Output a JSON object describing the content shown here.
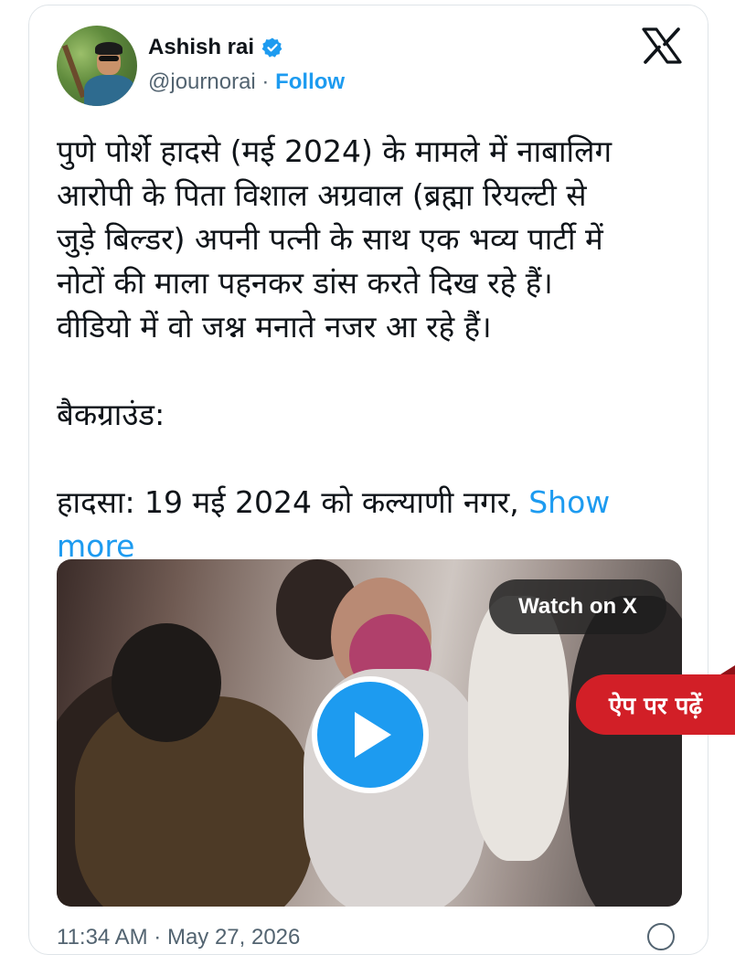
{
  "author": {
    "name": "Ashish rai",
    "handle": "@journorai",
    "separator": " · ",
    "follow_label": "Follow"
  },
  "tweet": {
    "text": "पुणे पोर्शे हादसे (मई 2024) के मामले में नाबालिग\nआरोपी के पिता विशाल अग्रवाल (ब्रह्मा रियल्टी से\nजुड़े बिल्डर) अपनी पत्नी के साथ एक भव्य पार्टी में\nनोटों की माला पहनकर डांस करते दिख रहे हैं।\nवीडियो में वो जश्न मनाते नजर आ रहे हैं।\n\nबैकग्राउंड:\n\nहादसा: 19 मई 2024 को कल्याणी नगर, ",
    "show_more": "Show\nmore"
  },
  "media": {
    "watch_label": "Watch on X"
  },
  "app_banner": {
    "label": "ऐप पर पढ़ें"
  },
  "footer": {
    "timestamp": "11:34 AM · May 27, 2026"
  },
  "colors": {
    "accent": "#1d9bf0",
    "banner": "#d21f27",
    "text": "#0f1419",
    "secondary": "#536471"
  },
  "icons": [
    "verified-badge-icon",
    "x-logo-icon",
    "play-icon",
    "info-icon"
  ]
}
